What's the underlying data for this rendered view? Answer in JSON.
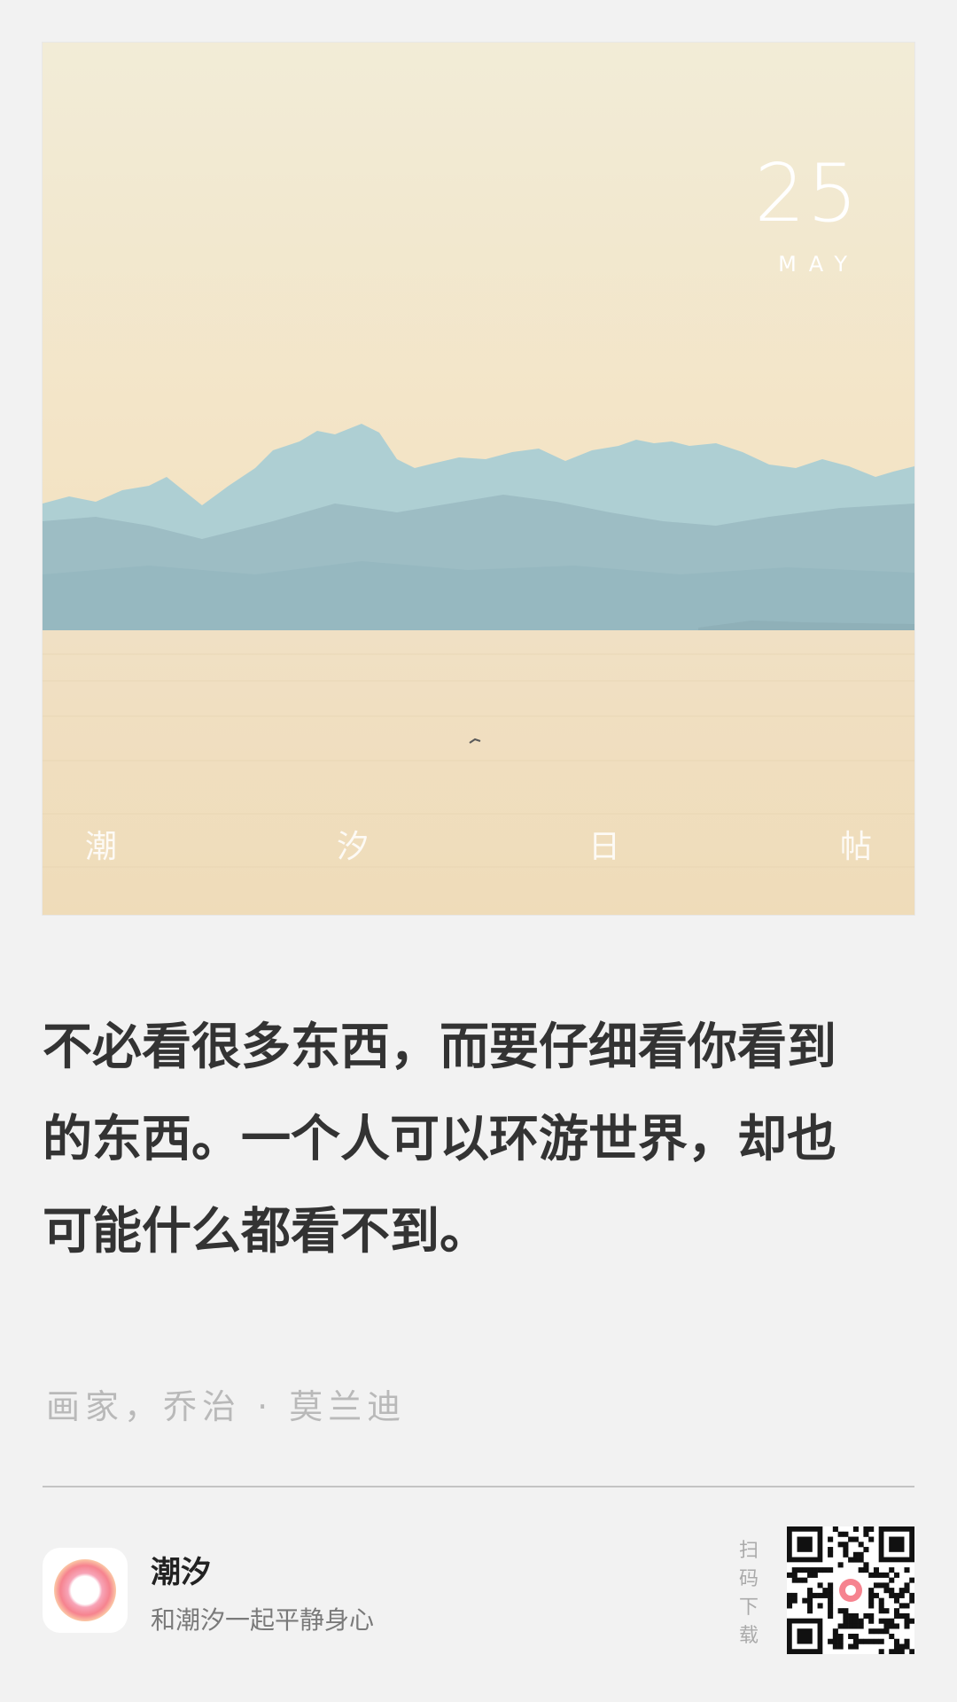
{
  "header": {
    "day": "25",
    "month": "MAY",
    "brand_chars": [
      "潮",
      "汐",
      "日",
      "帖"
    ]
  },
  "quote": {
    "lines": [
      "不必看很多东西，而要仔细看你看到",
      "的东西。一个人可以环游世界，却也",
      "可能什么都看不到。"
    ]
  },
  "attribution": "画家，乔治 · 莫兰迪",
  "footer": {
    "app_name": "潮汐",
    "slogan": "和潮汐一起平静身心",
    "scan_hint": [
      "扫",
      "码",
      "下",
      "载"
    ],
    "app_icon": "tide-app-icon",
    "qr_icon": "qr-code-icon"
  },
  "colors": {
    "background": "#f2f2f2",
    "sky_top": "#f2ecd6",
    "sky_bottom": "#f3dcb5",
    "mountain": "#9cc0c7",
    "sea": "#efdcba",
    "text_dark": "#333333",
    "text_muted": "#b9b9b9"
  }
}
